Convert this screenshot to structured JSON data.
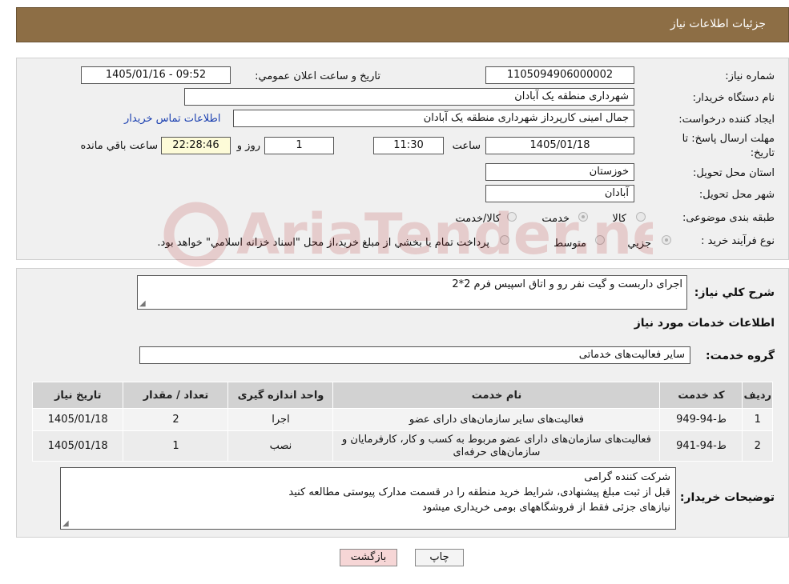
{
  "header": {
    "title": "جزئیات اطلاعات نیاز"
  },
  "fields": {
    "need_number_label": "شماره نیاز:",
    "need_number": "1105094906000002",
    "announce_label": "تاریخ و ساعت اعلان عمومي:",
    "announce_value": "1405/01/16 - 09:52",
    "buyer_org_label": "نام دستگاه خريدار:",
    "buyer_org": "شهرداری منطقه یک آبادان",
    "creator_label": "ایجاد کننده درخواست:",
    "creator": "جمال امینی کارپرداز شهرداری منطقه یک آبادان",
    "contact_link": "اطلاعات تماس خريدار",
    "deadline_label_1": "مهلت ارسال پاسخ: تا",
    "deadline_label_2": "تاریخ:",
    "deadline_date": "1405/01/18",
    "time_label": "ساعت",
    "deadline_time": "11:30",
    "days_value": "1",
    "days_label": "روز و",
    "remaining_time": "22:28:46",
    "remaining_label": "ساعت باقي مانده",
    "province_label": "استان محل تحويل:",
    "province": "خوزستان",
    "city_label": "شهر محل تحويل:",
    "city": "آبادان",
    "category_label": "طبقه بندی موضوعی:",
    "category_options": [
      "کالا",
      "خدمت",
      "کالا/خدمت"
    ],
    "process_label": "نوع فرآيند خريد :",
    "process_options": [
      "جزيي",
      "متوسط"
    ],
    "payment_note": "پرداخت تمام يا بخشي از مبلغ خريد،از محل \"اسناد خزانه اسلامي\" خواهد بود."
  },
  "description": {
    "label": "شرح کلي نياز:",
    "text": "اجرای داربست و گیت نفر رو و اتاق اسپیس فرم 2*2"
  },
  "services": {
    "section_title": "اطلاعات خدمات مورد نياز",
    "group_label": "گروه خدمت:",
    "group_value": "سایر فعالیت‌های خدماتی",
    "columns": [
      "رديف",
      "کد خدمت",
      "نام خدمت",
      "واحد اندازه گيری",
      "تعداد / مقدار",
      "تاريخ نياز"
    ],
    "rows": [
      {
        "row": "1",
        "code": "ط-94-949",
        "name": "فعالیت‌های سایر سازمان‌های دارای عضو",
        "unit": "اجرا",
        "qty": "2",
        "date": "1405/01/18"
      },
      {
        "row": "2",
        "code": "ط-94-941",
        "name": "فعالیت‌های سازمان‌های دارای عضو مربوط به کسب و کار، کارفرمایان و سازمان‌های حرفه‌ای",
        "unit": "نصب",
        "qty": "1",
        "date": "1405/01/18"
      }
    ]
  },
  "buyer_notes": {
    "label": "توضيحات خريدار:",
    "lines": [
      "شرکت کننده گرامی",
      "قبل از ثبت مبلغ پیشنهادی، شرایط خرید منطقه را در قسمت مدارک پیوستی مطالعه کنید",
      "نیازهای جزئی فقط از فروشگاههای بومی خریداری میشود"
    ]
  },
  "buttons": {
    "print": "چاپ",
    "back": "بازگشت"
  },
  "watermark_text": "AriaTender.neT",
  "colors": {
    "header_bg": "#8d6e45",
    "link": "#1a3fb0",
    "back_button": "#f6d6d6"
  }
}
